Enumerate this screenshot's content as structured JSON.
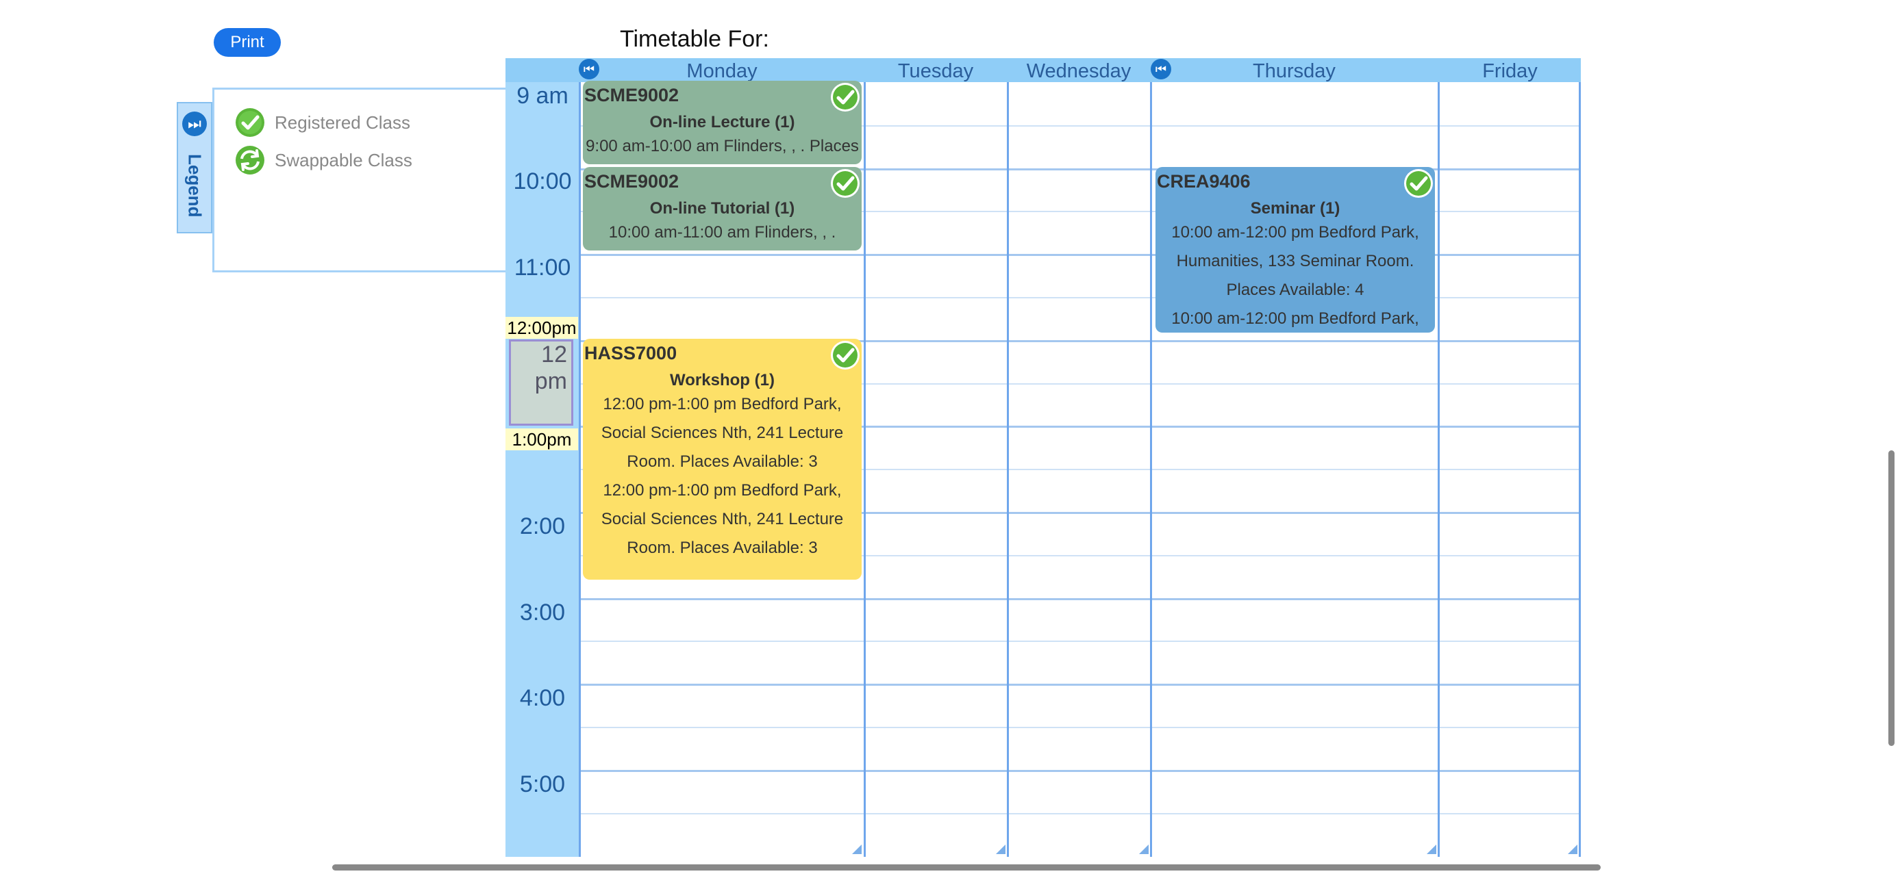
{
  "toolbar": {
    "print_label": "Print"
  },
  "timetable_title": "Timetable For:",
  "legend": {
    "tab_label": "Legend",
    "items": [
      {
        "label": "Registered Class",
        "icon": "check-icon"
      },
      {
        "label": "Swappable Class",
        "icon": "swap-icon"
      }
    ]
  },
  "days": [
    "Monday",
    "Tuesday",
    "Wednesday",
    "Thursday",
    "Friday"
  ],
  "times": [
    "9 am",
    "10:00",
    "11:00",
    "12",
    "pm",
    "2:00",
    "3:00",
    "4:00",
    "5:00"
  ],
  "highlights": {
    "start": "12:00pm",
    "end": "1:00pm"
  },
  "events": {
    "scme_lecture": {
      "code": "SCME9002",
      "type": "On-line Lecture (1)",
      "line1": "9:00 am-10:00 am Flinders, , . Places"
    },
    "scme_tutorial": {
      "code": "SCME9002",
      "type": "On-line Tutorial (1)",
      "line1": "10:00 am-11:00 am Flinders, , ."
    },
    "hass_workshop": {
      "code": "HASS7000",
      "type": "Workshop (1)",
      "lines": [
        "12:00 pm-1:00 pm Bedford Park,",
        "Social Sciences Nth, 241 Lecture",
        "Room. Places Available: 3",
        "12:00 pm-1:00 pm Bedford Park,",
        "Social Sciences Nth, 241 Lecture",
        "Room. Places Available: 3"
      ]
    },
    "crea_seminar": {
      "code": "CREA9406",
      "type": "Seminar (1)",
      "lines": [
        "10:00 am-12:00 pm Bedford Park,",
        "Humanities, 133 Seminar Room.",
        "Places Available: 4",
        "10:00 am-12:00 pm Bedford Park,"
      ]
    }
  },
  "colors": {
    "header": "#8fcdf7",
    "time_column": "#a7d9fb",
    "online_event": "#8cb49b",
    "workshop_event": "#fde068",
    "seminar_event": "#67a7d8",
    "check_green": "#5bb63a"
  }
}
